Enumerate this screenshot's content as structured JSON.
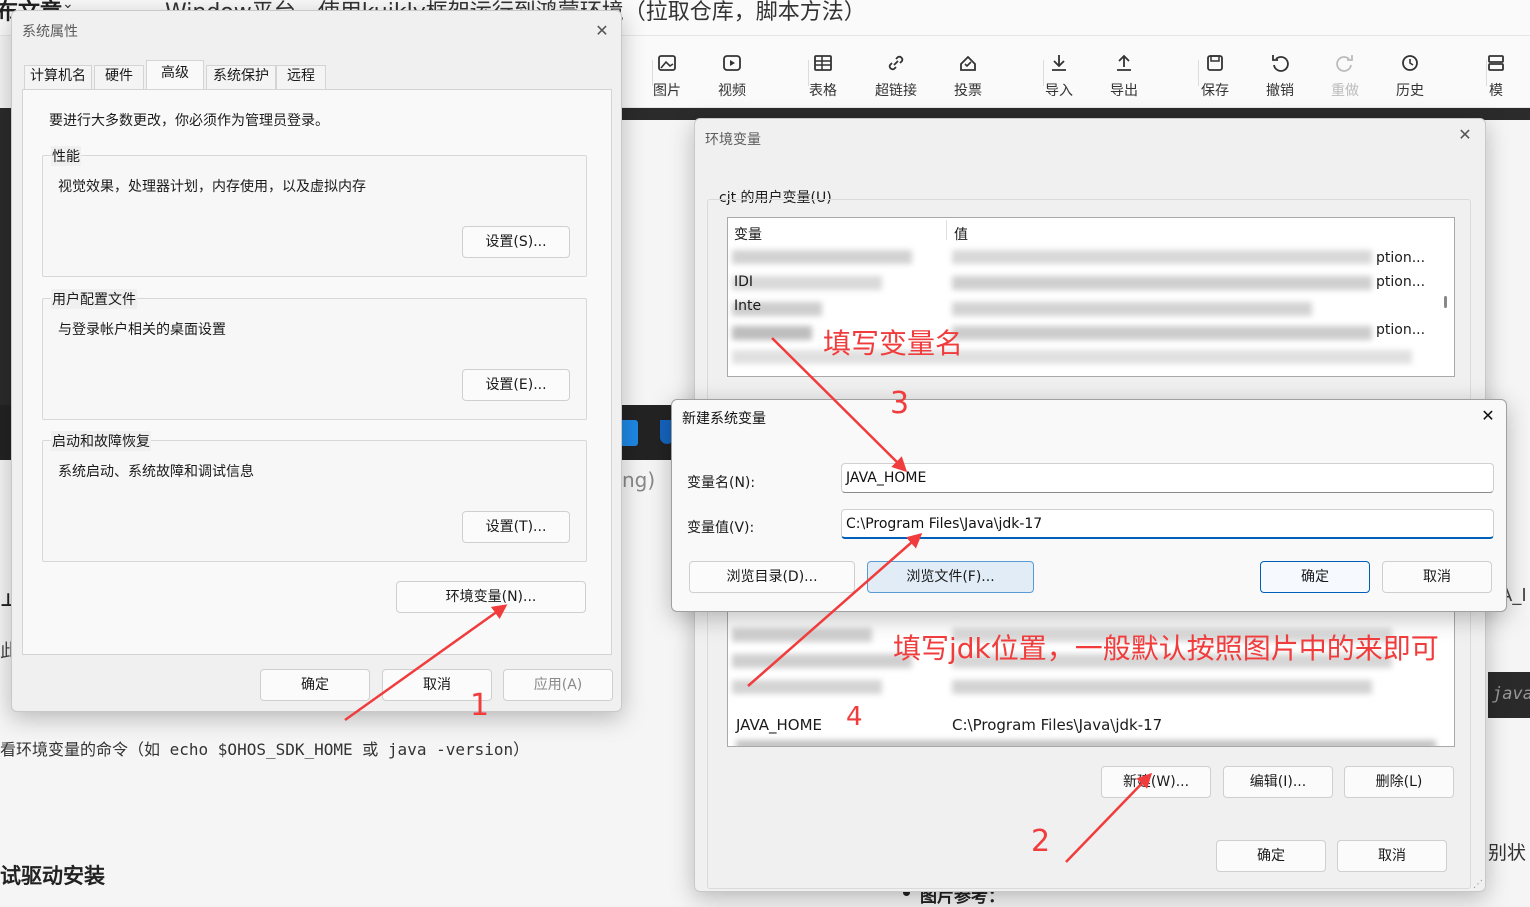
{
  "bg_article": {
    "title": "Window平台，使用kuikly框架运行到鸿蒙环境（拉取仓库，脚本方法）",
    "left_heading": "布文章",
    "command_line": "看环境变量的命令（如 echo $OHOS_SDK_HOME 或 java -version）",
    "section_heading": "试驱动安装",
    "side_text_ng": "ng)",
    "side_right_1": "A_I",
    "side_right_2": "java",
    "side_right_3": "别状",
    "bullet_text": "图片参考："
  },
  "toolbar": {
    "items": [
      {
        "label": "图片",
        "icon": "image-icon"
      },
      {
        "label": "视频",
        "icon": "video-icon"
      },
      {
        "label": "表格",
        "icon": "table-icon"
      },
      {
        "label": "超链接",
        "icon": "link-icon"
      },
      {
        "label": "投票",
        "icon": "vote-icon"
      },
      {
        "label": "导入",
        "icon": "import-icon"
      },
      {
        "label": "导出",
        "icon": "export-icon"
      },
      {
        "label": "保存",
        "icon": "save-icon"
      },
      {
        "label": "撤销",
        "icon": "undo-icon"
      },
      {
        "label": "重做",
        "icon": "redo-icon"
      },
      {
        "label": "历史",
        "icon": "history-icon"
      },
      {
        "label": "模",
        "icon": "template-icon"
      }
    ]
  },
  "sysprops": {
    "title": "系统属性",
    "tabs": [
      "计算机名",
      "硬件",
      "高级",
      "系统保护",
      "远程"
    ],
    "active_tab": "高级",
    "admin_note": "要进行大多数更改，你必须作为管理员登录。",
    "performance": {
      "title": "性能",
      "desc": "视觉效果，处理器计划，内存使用，以及虚拟内存",
      "button": "设置(S)..."
    },
    "user_profile": {
      "title": "用户配置文件",
      "desc": "与登录帐户相关的桌面设置",
      "button": "设置(E)..."
    },
    "startup": {
      "title": "启动和故障恢复",
      "desc": "系统启动、系统故障和调试信息",
      "button": "设置(T)..."
    },
    "env_button": "环境变量(N)...",
    "ok": "确定",
    "cancel": "取消",
    "apply": "应用(A)"
  },
  "envvars": {
    "title": "环境变量",
    "user_section": "cjt 的用户变量(U)",
    "col_var": "变量",
    "col_val": "值",
    "user_rows": [
      {
        "name": "",
        "value": "ption..."
      },
      {
        "name": "IDI",
        "value": "ption..."
      },
      {
        "name": "Inte",
        "value": ""
      },
      {
        "name": "",
        "value": "ption..."
      }
    ],
    "sys_rows": [
      {
        "name": "JAVA_HOME",
        "value": "C:\\Program Files\\Java\\jdk-17"
      }
    ],
    "new_btn": "新建(W)...",
    "edit_btn": "编辑(I)...",
    "delete_btn": "删除(L)",
    "ok": "确定",
    "cancel": "取消"
  },
  "newvar": {
    "title": "新建系统变量",
    "name_label": "变量名(N):",
    "name_value": "JAVA_HOME",
    "value_label": "变量值(V):",
    "value_value": "C:\\Program Files\\Java\\jdk-17",
    "browse_dir": "浏览目录(D)...",
    "browse_file": "浏览文件(F)...",
    "ok": "确定",
    "cancel": "取消"
  },
  "annotations": {
    "n1": "1",
    "n2": "2",
    "n3": "3",
    "n4": "4",
    "fill_name": "填写变量名",
    "fill_jdk": "填写jdk位置，一般默认按照图片中的来即可",
    "color": "#f03c3c"
  }
}
